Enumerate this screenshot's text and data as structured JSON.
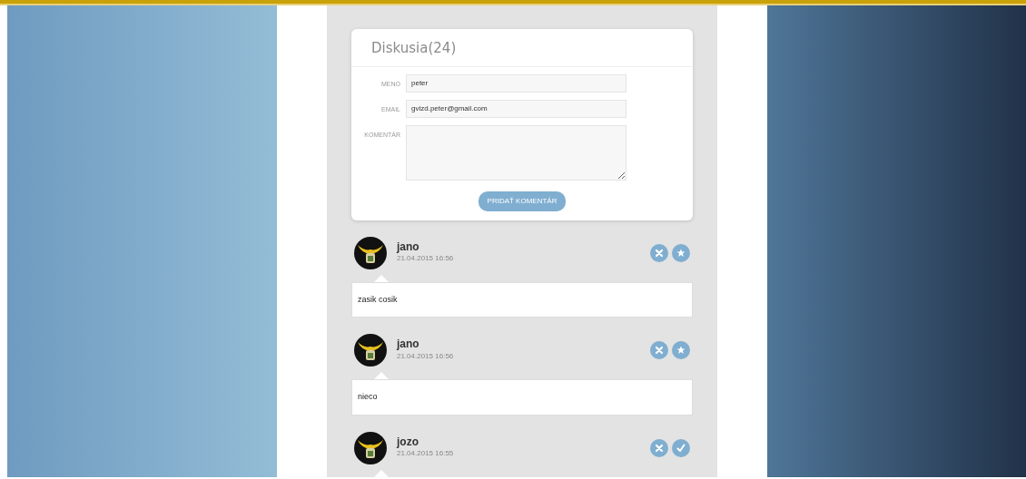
{
  "discussion": {
    "title": "Diskusia(24)",
    "fields": [
      {
        "label": "MENO",
        "value": "peter",
        "kind": "input"
      },
      {
        "label": "EMAIL",
        "value": "gvizd.peter@gmail.com",
        "kind": "input"
      },
      {
        "label": "KOMENTÁR",
        "kind": "textarea"
      }
    ],
    "submit": "PRIDAŤ KOMENTÁR"
  },
  "comments": [
    {
      "author": "jano",
      "time": "21.04.2015 16:56",
      "text": "zasik cosik",
      "actions": [
        {
          "kind": "delete"
        },
        {
          "kind": "star"
        }
      ]
    },
    {
      "author": "jano",
      "time": "21.04.2015 16:56",
      "text": "nieco",
      "actions": [
        {
          "kind": "delete"
        },
        {
          "kind": "star"
        }
      ]
    },
    {
      "author": "jozo",
      "time": "21.04.2015 16:55",
      "actions": [
        {
          "kind": "delete"
        },
        {
          "kind": "approve"
        }
      ]
    }
  ]
}
